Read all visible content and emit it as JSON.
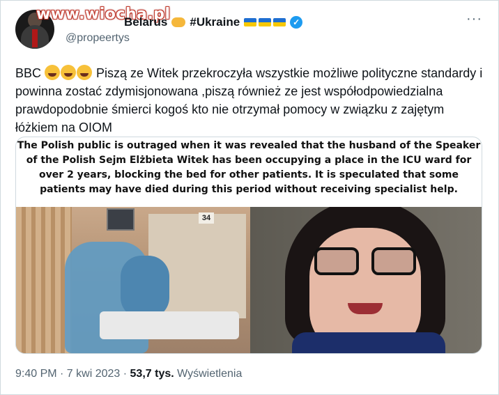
{
  "tweet": {
    "display_name_prefix": "Belarus",
    "display_name_tag": "#Ukraine",
    "handle": "@propeertys",
    "more_label": "···",
    "text_prefix": "BBC",
    "text_body": " Piszą ze Witek przekroczyła wszystkie możliwe polityczne standardy i powinna zostać zdymisjonowana ,piszą również ze jest współodpowiedzialna prawdopodobnie śmierci kogoś kto nie otrzymał pomocy w związku z zajętym łóżkiem na OIOM",
    "timestamp": "9:40 PM · 7 kwi 2023 ·",
    "views_count": "53,7 tys.",
    "views_label": "Wyświetlenia"
  },
  "watermark": "www.wiocha.pl",
  "media": {
    "caption": "The Polish public is outraged when it was revealed that the husband of the Speaker of the Polish Sejm Elżbieta Witek has been occupying a place in the ICU ward for over 2 years, blocking the bed for other patients. It is speculated that some patients may have died during this period without receiving specialist help.",
    "room_number": "34"
  },
  "colors": {
    "verified": "#1d9bf0",
    "flag_blue": "#1f6fd1",
    "flag_yellow": "#f7c800",
    "secondary_text": "#536471"
  },
  "icons": [
    "handshake-emoji",
    "ukraine-flag-emoji",
    "verified-badge-icon",
    "laughing-emoji"
  ]
}
